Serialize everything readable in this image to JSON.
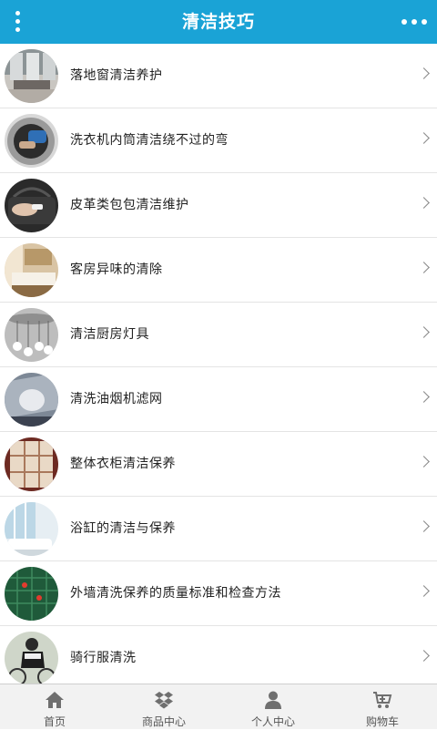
{
  "header": {
    "title": "清洁技巧",
    "menu_icon": "vertical-dots-icon",
    "more_icon": "horizontal-dots-icon",
    "background_color": "#1aa3d6"
  },
  "articles": [
    {
      "title": "落地窗清洁养护",
      "thumb": "living-room-photo"
    },
    {
      "title": "洗衣机内筒清洁绕不过的弯",
      "thumb": "washing-machine-photo"
    },
    {
      "title": "皮革类包包清洁维护",
      "thumb": "leather-bag-photo"
    },
    {
      "title": "客房异味的清除",
      "thumb": "hotel-room-photo"
    },
    {
      "title": "清洁厨房灯具",
      "thumb": "pendant-lamps-photo"
    },
    {
      "title": "清洗油烟机滤网",
      "thumb": "range-hood-photo"
    },
    {
      "title": "整体衣柜清洁保养",
      "thumb": "wardrobe-photo"
    },
    {
      "title": "浴缸的清洁与保养",
      "thumb": "bathroom-photo"
    },
    {
      "title": "外墙清洗保养的质量标准和检查方法",
      "thumb": "building-facade-photo"
    },
    {
      "title": "骑行服清洗",
      "thumb": "cyclist-photo"
    }
  ],
  "tabbar": {
    "items": [
      {
        "label": "首页",
        "icon": "home-icon"
      },
      {
        "label": "商品中心",
        "icon": "dropbox-box-icon"
      },
      {
        "label": "个人中心",
        "icon": "user-icon"
      },
      {
        "label": "购物车",
        "icon": "cart-icon"
      }
    ]
  }
}
